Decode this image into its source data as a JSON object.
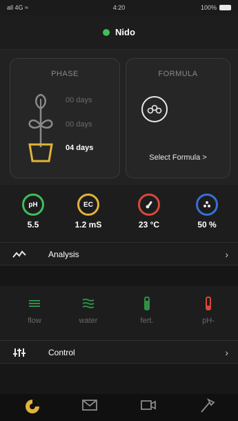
{
  "status_bar": {
    "signal": "all 4G ≈",
    "time": "4:20",
    "battery": "100%"
  },
  "device": {
    "name": "Nido",
    "status_color": "#3fbf5a"
  },
  "phase_card": {
    "title": "PHASE",
    "values": [
      "00 days",
      "00 days",
      "04 days"
    ],
    "icon": "plant-growth-icon",
    "accent": "#e0b43a"
  },
  "formula_card": {
    "title": "FORMULA",
    "link": "Select Formula >",
    "icon": "molecule-icon"
  },
  "sensors": [
    {
      "label": "pH",
      "value": "5.5",
      "color": "#3fbf5a"
    },
    {
      "label": "EC",
      "value": "1.2 mS",
      "color": "#e0b43a"
    },
    {
      "label": "temp",
      "value": "23 °C",
      "color": "#d9483b",
      "icon": "thermometer-icon"
    },
    {
      "label": "humidity",
      "value": "50 %",
      "color": "#3a6fd9",
      "icon": "humidity-icon"
    }
  ],
  "analysis": {
    "label": "Analysis",
    "icon": "trend-line-icon"
  },
  "actuators": [
    {
      "label": "flow",
      "icon": "flow-icon",
      "color": "#2f8f45"
    },
    {
      "label": "water",
      "icon": "water-icon",
      "color": "#2f8f45"
    },
    {
      "label": "fert.",
      "icon": "fertilizer-icon",
      "color": "#2f8f45"
    },
    {
      "label": "pH-",
      "icon": "ph-minus-icon",
      "color": "#d9483b"
    }
  ],
  "control": {
    "label": "Control",
    "icon": "sliders-icon"
  },
  "tabs": [
    {
      "name": "dashboard",
      "icon": "dashboard-icon",
      "active": true
    },
    {
      "name": "messages",
      "icon": "mail-icon",
      "active": false
    },
    {
      "name": "camera",
      "icon": "video-icon",
      "active": false
    },
    {
      "name": "tools",
      "icon": "tools-icon",
      "active": false
    }
  ]
}
